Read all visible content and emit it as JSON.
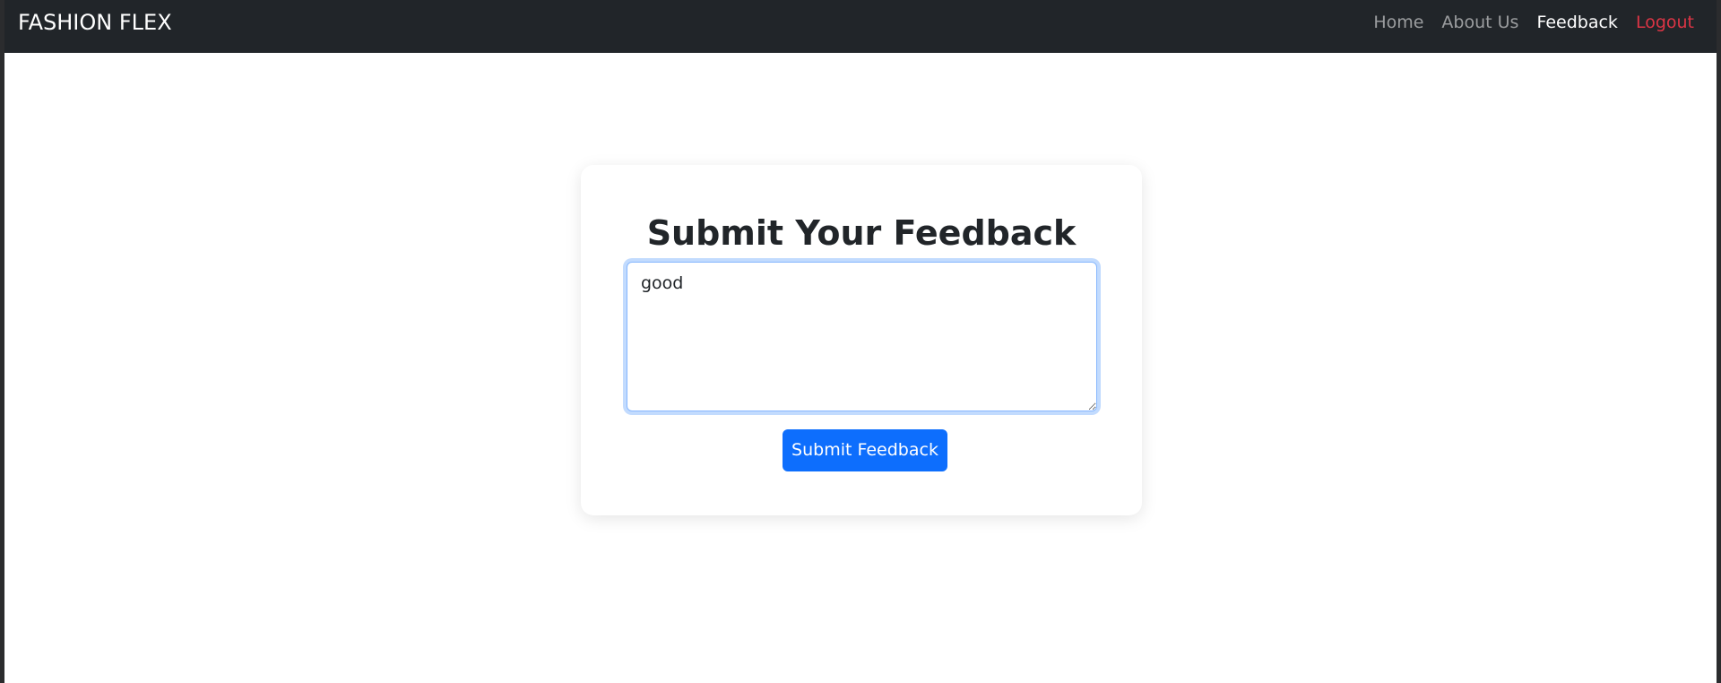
{
  "navbar": {
    "brand": "FASHION FLEX",
    "links": [
      {
        "label": "Home",
        "state": "inactive"
      },
      {
        "label": "About Us",
        "state": "inactive"
      },
      {
        "label": "Feedback",
        "state": "active"
      },
      {
        "label": "Logout",
        "state": "danger"
      }
    ],
    "background_color": "#212529"
  },
  "feedback_form": {
    "title": "Submit Your Feedback",
    "textarea_value": "good",
    "submit_label": "Submit Feedback",
    "button_color": "#0d6efd"
  }
}
